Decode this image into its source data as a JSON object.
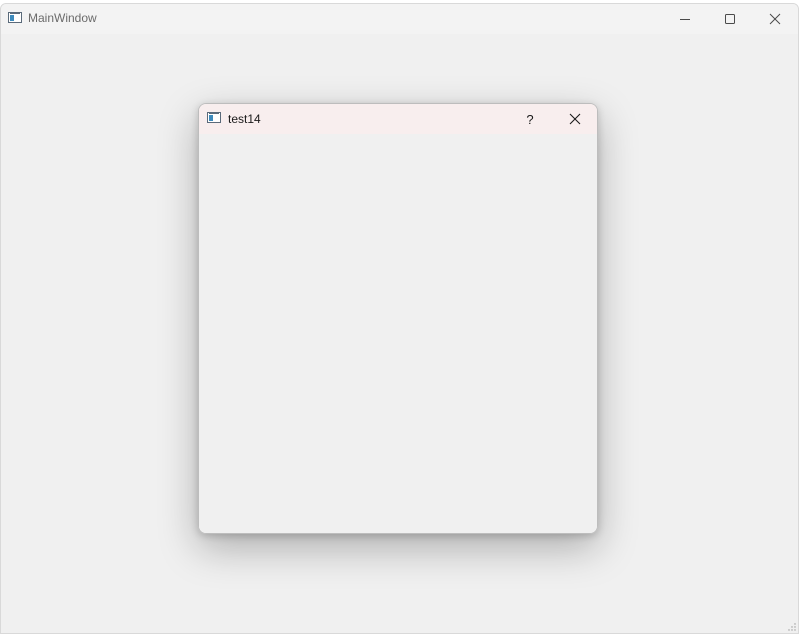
{
  "main_window": {
    "title": "MainWindow",
    "icon": "app-window-icon",
    "controls": {
      "minimize_icon": "minimize-icon",
      "maximize_icon": "maximize-icon",
      "close_icon": "close-icon"
    }
  },
  "dialog": {
    "title": "test14",
    "icon": "app-window-icon",
    "help_label": "?",
    "close_icon": "close-icon"
  },
  "colors": {
    "window_background": "#f0f0f0",
    "dialog_titlebar": "#f8eeee",
    "main_title_text": "#6b6b6b"
  }
}
